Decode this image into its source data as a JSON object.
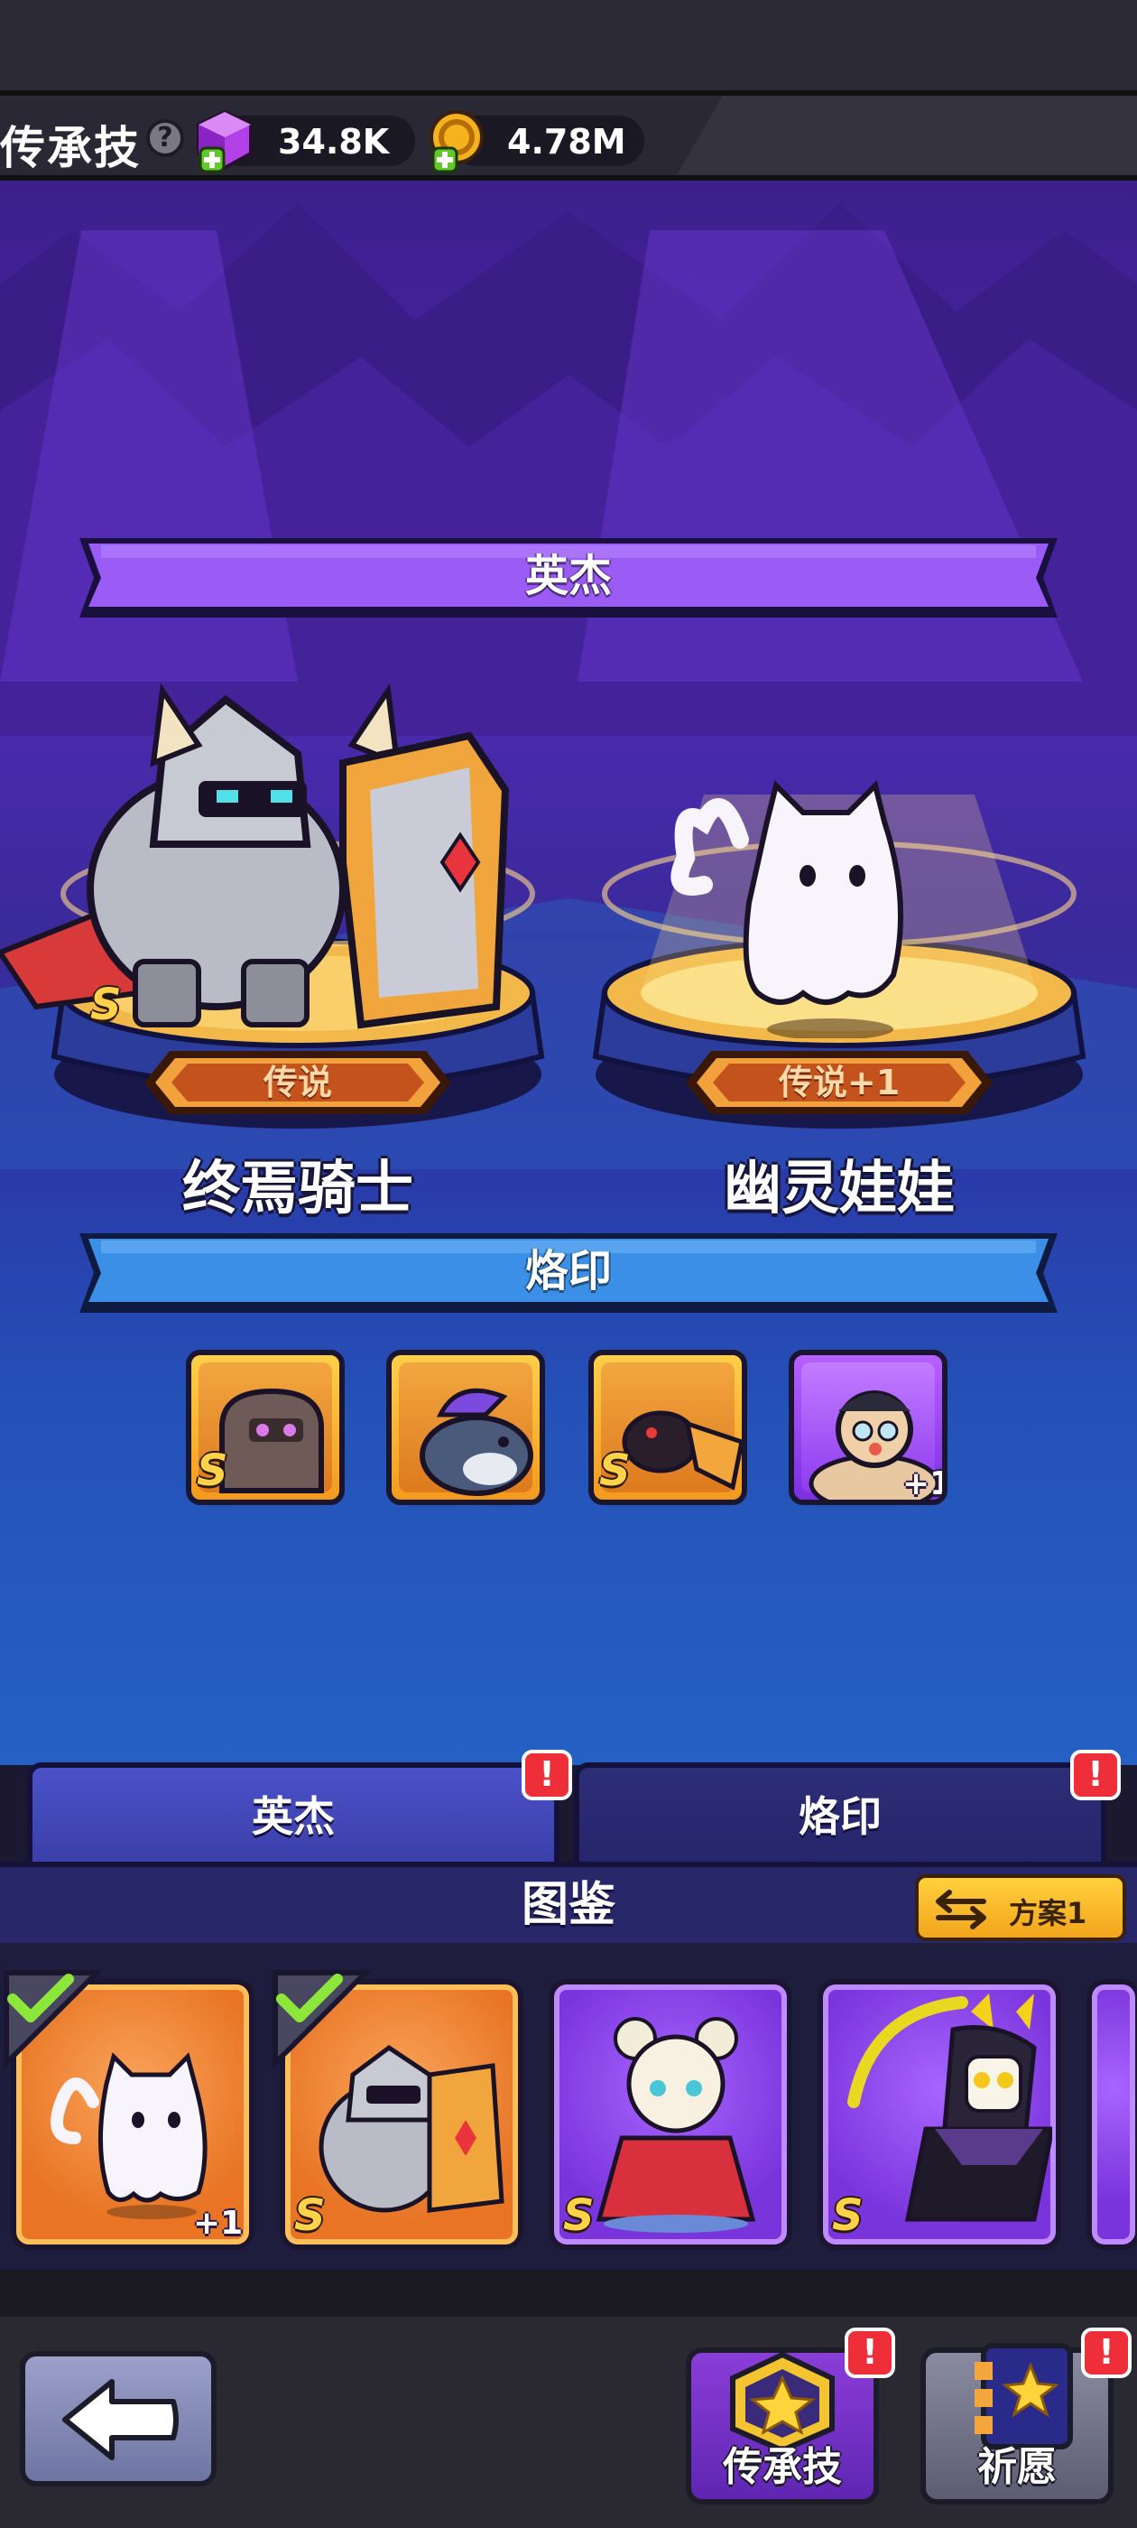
{
  "header": {
    "title": "传承技",
    "help_icon": "question-circle-icon",
    "gems": {
      "icon": "purple-gem-plus-icon",
      "value": "34.8K"
    },
    "gold": {
      "icon": "gold-coin-plus-icon",
      "value": "4.78M"
    }
  },
  "hero_section": {
    "banner": "英杰",
    "heroes": [
      {
        "name": "终焉骑士",
        "rank": "传说",
        "grade": "S"
      },
      {
        "name": "幽灵娃娃",
        "rank": "传说+1",
        "grade": ""
      }
    ]
  },
  "imprint_section": {
    "banner": "烙印",
    "items": [
      {
        "name": "golem",
        "grade": "S",
        "bonus": ""
      },
      {
        "name": "fish-creature",
        "grade": "",
        "bonus": ""
      },
      {
        "name": "crow",
        "grade": "S",
        "bonus": ""
      },
      {
        "name": "brawler",
        "grade": "",
        "bonus": "+1"
      }
    ]
  },
  "tabs": [
    {
      "label": "英杰",
      "alert": "!"
    },
    {
      "label": "烙印",
      "alert": "!"
    }
  ],
  "codex": {
    "title": "图鉴",
    "plan_button": "方案1",
    "cards": [
      {
        "name": "ghost-doll",
        "selected": true,
        "grade": "",
        "bonus": "+1"
      },
      {
        "name": "doom-knight",
        "selected": true,
        "grade": "S",
        "bonus": ""
      },
      {
        "name": "lady-doll",
        "selected": false,
        "grade": "S",
        "bonus": ""
      },
      {
        "name": "reaper",
        "selected": false,
        "grade": "S",
        "bonus": ""
      }
    ]
  },
  "bottom_nav": {
    "back_icon": "arrow-left-icon",
    "legacy": {
      "label": "传承技",
      "alert": "!"
    },
    "wish": {
      "label": "祈愿",
      "alert": "!"
    }
  },
  "colors": {
    "banner_purple": "#8a4cf0",
    "banner_blue": "#3a8ee8",
    "gold": "#ffd24a",
    "alert_red": "#ee2f3a"
  }
}
